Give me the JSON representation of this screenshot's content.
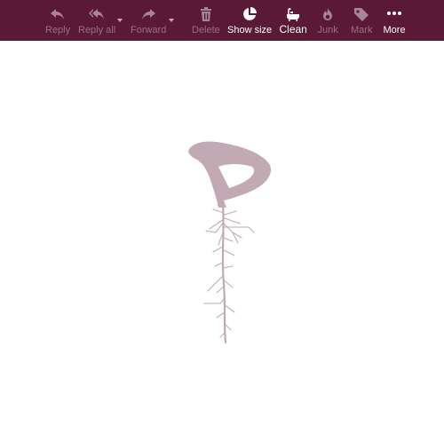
{
  "toolbar": {
    "items": [
      {
        "label": "Reply",
        "icon": "reply-icon",
        "enabled": false
      },
      {
        "label": "Reply all",
        "icon": "reply-all-icon",
        "enabled": false
      },
      {
        "label": "Forward",
        "icon": "forward-icon",
        "enabled": false
      },
      {
        "label": "Delete",
        "icon": "trash-icon",
        "enabled": false
      },
      {
        "label": "Show size",
        "icon": "pie-chart-icon",
        "enabled": true
      },
      {
        "label": "Clean",
        "icon": "bathtub-icon",
        "enabled": true
      },
      {
        "label": "Junk",
        "icon": "flame-icon",
        "enabled": false
      },
      {
        "label": "Mark",
        "icon": "tag-icon",
        "enabled": false
      },
      {
        "label": "More",
        "icon": "more-dots-icon",
        "enabled": true
      }
    ]
  },
  "colors": {
    "toolbar_bg": "#5a1a35",
    "label_disabled": "#9a6f84",
    "label_enabled": "#ffffff",
    "icon_disabled": "#a98399",
    "logo": "#c2aab5"
  },
  "logo": {
    "icon": "root-logo-icon"
  }
}
